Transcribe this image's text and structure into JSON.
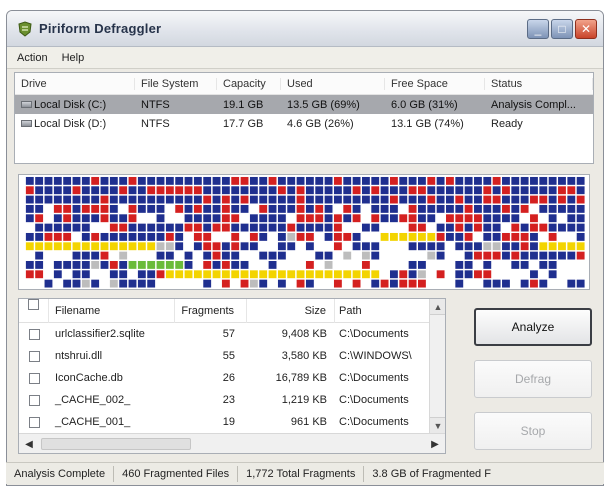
{
  "window": {
    "title": "Piriform Defraggler",
    "controls": [
      "_",
      "□",
      "✕"
    ]
  },
  "menu": [
    "Action",
    "Help"
  ],
  "drives": {
    "columns": [
      "Drive",
      "File System",
      "Capacity",
      "Used",
      "Free Space",
      "Status"
    ],
    "rows": [
      [
        "Local Disk (C:)",
        "NTFS",
        "19.1 GB",
        "13.5 GB (69%)",
        "6.0 GB (31%)",
        "Analysis Compl..."
      ],
      [
        "Local Disk (D:)",
        "NTFS",
        "17.7 GB",
        "4.6 GB (26%)",
        "13.1 GB (74%)",
        "Ready"
      ]
    ]
  },
  "diskmap": {
    "colors": {
      "blue": "#1f2f8f",
      "red": "#d42020",
      "yellow": "#f3d400",
      "green": "#6bbb3a",
      "white": "#ffffff",
      "grey": "#bdbdbd"
    }
  },
  "files": {
    "columns": [
      "",
      "Filename",
      "Fragments",
      "Size",
      "Path"
    ],
    "rows": [
      [
        "urlclassifier2.sqlite",
        "57",
        "9,408 KB",
        "C:\\Documents"
      ],
      [
        "ntshrui.dll",
        "55",
        "3,580 KB",
        "C:\\WINDOWS\\"
      ],
      [
        "IconCache.db",
        "26",
        "16,789 KB",
        "C:\\Documents"
      ],
      [
        "_CACHE_002_",
        "23",
        "1,219 KB",
        "C:\\Documents"
      ],
      [
        "_CACHE_001_",
        "19",
        "961 KB",
        "C:\\Documents"
      ]
    ]
  },
  "buttons": {
    "analyze": "Analyze",
    "defrag": "Defrag",
    "stop": "Stop"
  },
  "status": {
    "state": "Analysis Complete",
    "fragmented_files": "460 Fragmented Files",
    "total_fragments": "1,772 Total Fragments",
    "fragmented_size": "3.8 GB of Fragmented F"
  }
}
